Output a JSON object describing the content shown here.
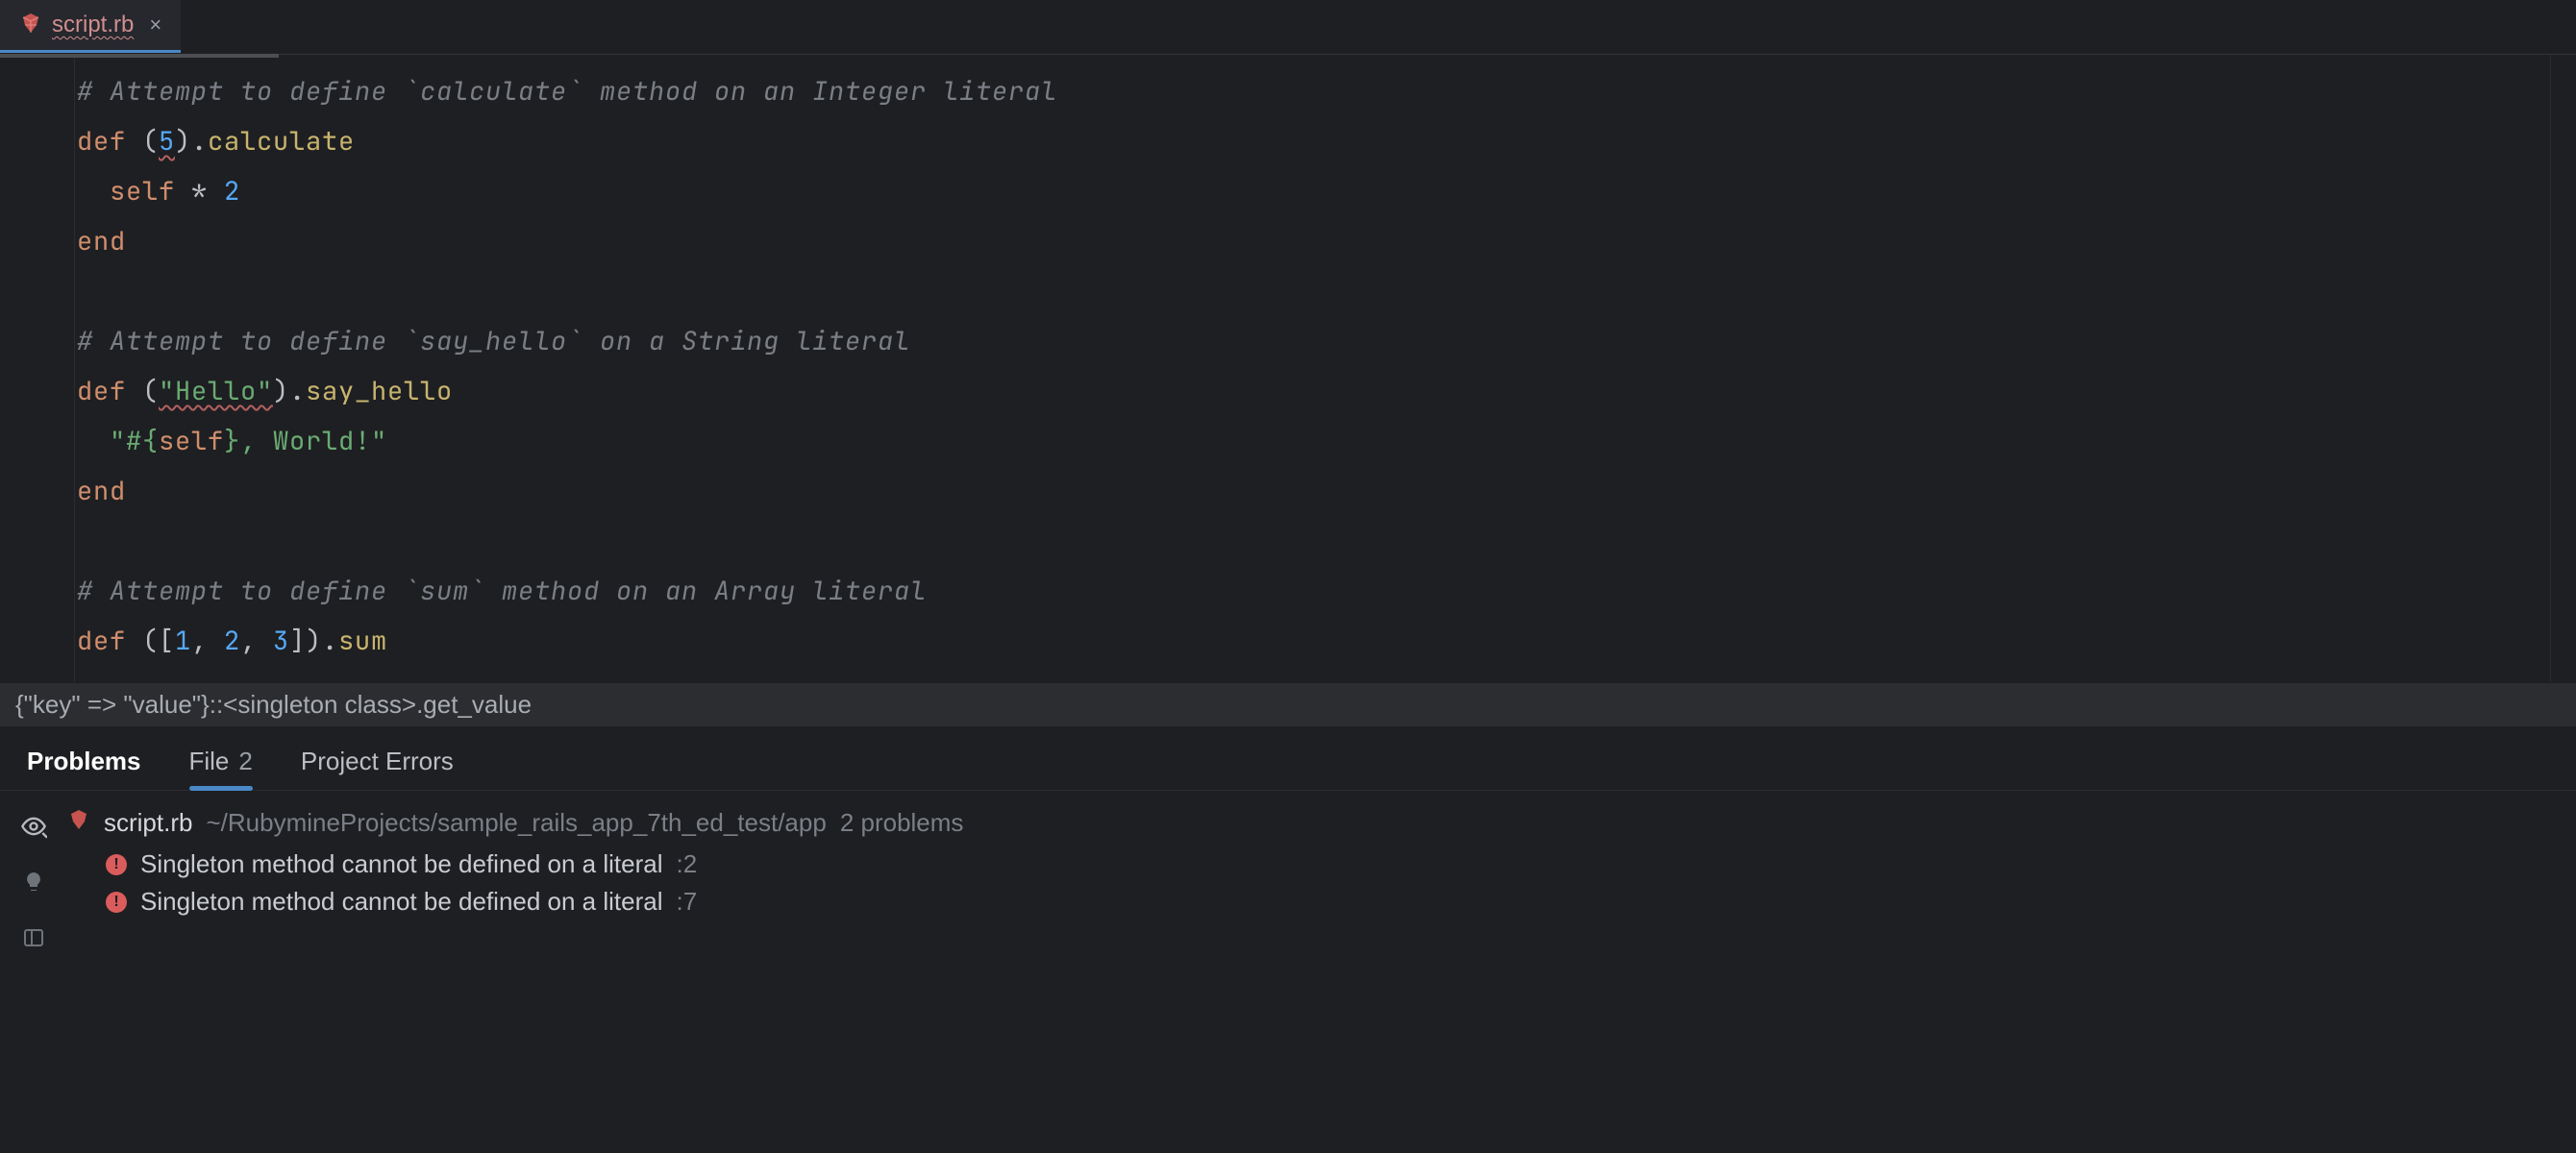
{
  "tab": {
    "filename": "script.rb",
    "close_glyph": "×"
  },
  "breadcrumb": "{\"key\" => \"value\"}::<singleton class>.get_value",
  "panel": {
    "title": "Problems",
    "file_tab_label": "File",
    "file_tab_count": "2",
    "project_errors_label": "Project Errors",
    "file": {
      "name": "script.rb",
      "path": "~/RubymineProjects/sample_rails_app_7th_ed_test/app",
      "count_label": "2 problems"
    },
    "problems": [
      {
        "message": "Singleton method cannot be defined on a literal",
        "location": ":2"
      },
      {
        "message": "Singleton method cannot be defined on a literal",
        "location": ":7"
      }
    ]
  },
  "code": {
    "l1_comment": "# Attempt to define `calculate` method on an Integer literal",
    "l2_def": "def",
    "l2_open": " (",
    "l2_num": "5",
    "l2_close": ").",
    "l2_method": "calculate",
    "l3_indent": "  ",
    "l3_self": "self",
    "l3_mul": " * ",
    "l3_two": "2",
    "l4_end": "end",
    "l6_comment": "# Attempt to define `say_hello` on a String literal",
    "l7_def": "def",
    "l7_open": " (",
    "l7_str": "\"Hello\"",
    "l7_close": ").",
    "l7_method": "say_hello",
    "l8_indent": "  ",
    "l8_s1": "\"#{",
    "l8_self": "self",
    "l8_s2": "}, World!\"",
    "l9_end": "end",
    "l11_comment": "# Attempt to define `sum` method on an Array literal",
    "l12_def": "def",
    "l12_open": " ([",
    "l12_n1": "1",
    "l12_c1": ", ",
    "l12_n2": "2",
    "l12_c2": ", ",
    "l12_n3": "3",
    "l12_close": "]).",
    "l12_method": "sum"
  }
}
